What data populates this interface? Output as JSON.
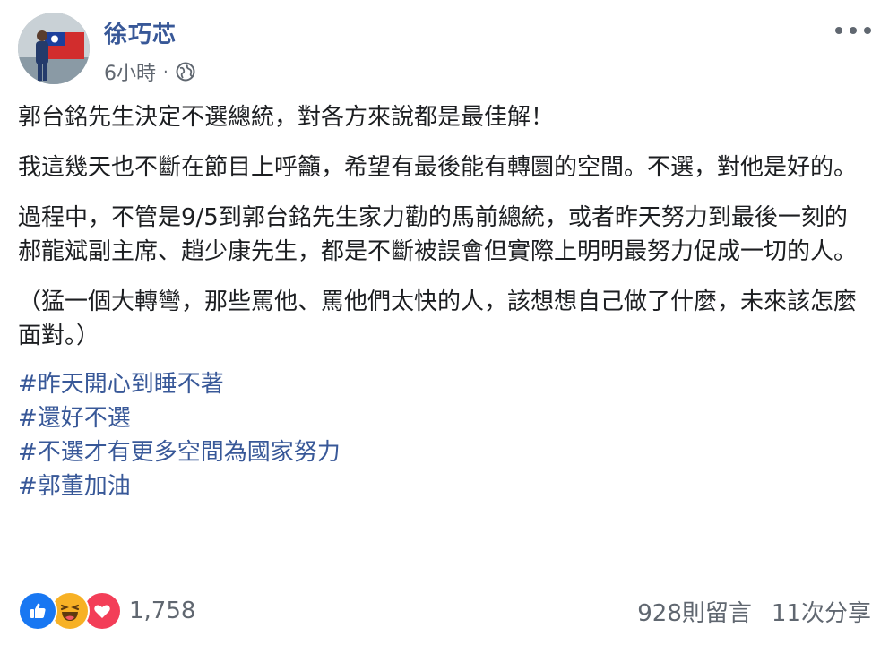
{
  "post": {
    "author": "徐巧芯",
    "timestamp": "6小時",
    "separator": "·",
    "privacy_icon": "globe-icon",
    "paragraphs": [
      "郭台銘先生決定不選總統，對各方來說都是最佳解！",
      "我這幾天也不斷在節目上呼籲，希望有最後能有轉圜的空間。不選，對他是好的。",
      "過程中，不管是9/5到郭台銘先生家力勸的馬前總統，或者昨天努力到最後一刻的郝龍斌副主席、趙少康先生，都是不斷被誤會但實際上明明最努力促成一切的人。",
      "（猛一個大轉彎，那些罵他、罵他們太快的人，該想想自己做了什麼，未來該怎麼面對。）"
    ],
    "hashtags": [
      "#昨天開心到睡不著",
      "#還好不選",
      "#不選才有更多空間為國家努力",
      "#郭董加油"
    ]
  },
  "footer": {
    "reaction_icons": [
      "like-icon",
      "haha-icon",
      "love-icon"
    ],
    "reaction_count": "1,758",
    "comments": "928則留言",
    "shares": "11次分享"
  },
  "colors": {
    "link": "#385898",
    "meta": "#606770",
    "text": "#1c1e21",
    "like": "#1877f2",
    "haha": "#f7b125",
    "love": "#f33e58"
  }
}
